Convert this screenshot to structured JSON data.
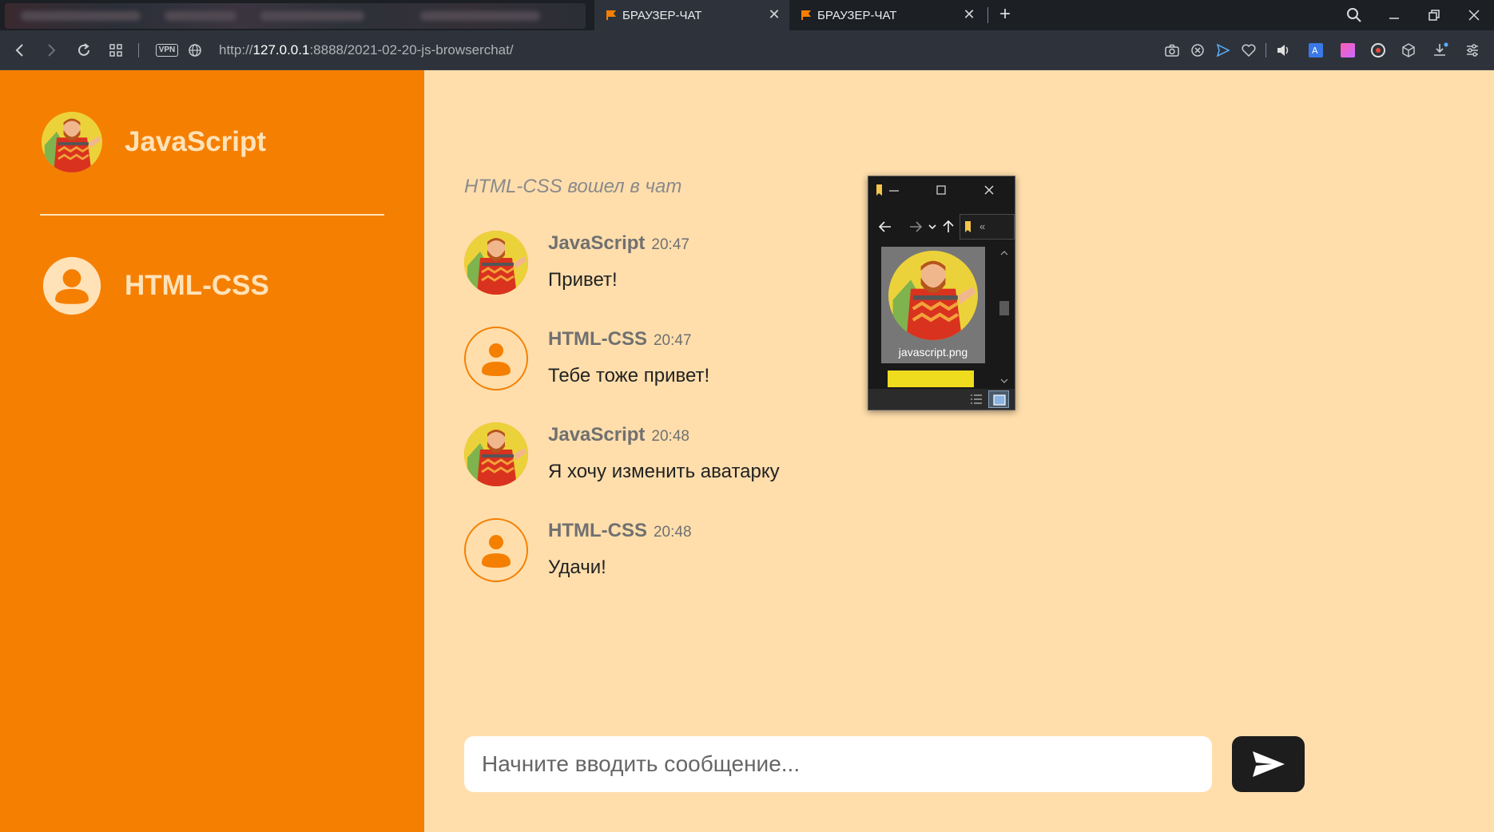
{
  "browser": {
    "tabs": [
      {
        "title": "БРАУЗЕР-ЧАТ",
        "active": true,
        "close": "✕"
      },
      {
        "title": "БРАУЗЕР-ЧАТ",
        "active": false,
        "close": "✕"
      }
    ],
    "new_tab": "+",
    "vpn_label": "VPN",
    "url": {
      "scheme": "http://",
      "host": "127.0.0.1",
      "rest": ":8888/2021-02-20-js-browserchat/"
    },
    "icons": {
      "back": "chevron-left-icon",
      "forward": "chevron-right-icon",
      "reload": "reload-icon",
      "tabs": "grid-icon",
      "globe": "globe-icon",
      "camera": "camera-icon",
      "adblock": "adblock-icon",
      "send": "send-icon",
      "heart": "heart-icon",
      "downloads": "download-icon",
      "settings": "settings-sliders-icon"
    }
  },
  "sidebar": {
    "users": [
      {
        "name": "JavaScript",
        "avatar": "javascript-avatar"
      },
      {
        "name": "HTML-CSS",
        "avatar": "default-user-avatar"
      }
    ]
  },
  "chat": {
    "system_message": "HTML-CSS вошел в чат",
    "messages": [
      {
        "author": "JavaScript",
        "time": "20:47",
        "text": "Привет!",
        "avatar": "javascript-avatar"
      },
      {
        "author": "HTML-CSS",
        "time": "20:47",
        "text": "Тебе тоже привет!",
        "avatar": "default-user-avatar"
      },
      {
        "author": "JavaScript",
        "time": "20:48",
        "text": "Я хочу изменить аватарку",
        "avatar": "javascript-avatar"
      },
      {
        "author": "HTML-CSS",
        "time": "20:48",
        "text": "Удачи!",
        "avatar": "default-user-avatar"
      }
    ],
    "composer": {
      "placeholder": "Начните вводить сообщение...",
      "value": ""
    }
  },
  "explorer": {
    "file_name": "javascript.png",
    "path_prefix": "«"
  },
  "colors": {
    "sidebar_bg": "#f57f00",
    "chat_bg": "#ffdeac",
    "sidebar_text": "#ffe2b8",
    "send_button": "#1d1d1d"
  }
}
